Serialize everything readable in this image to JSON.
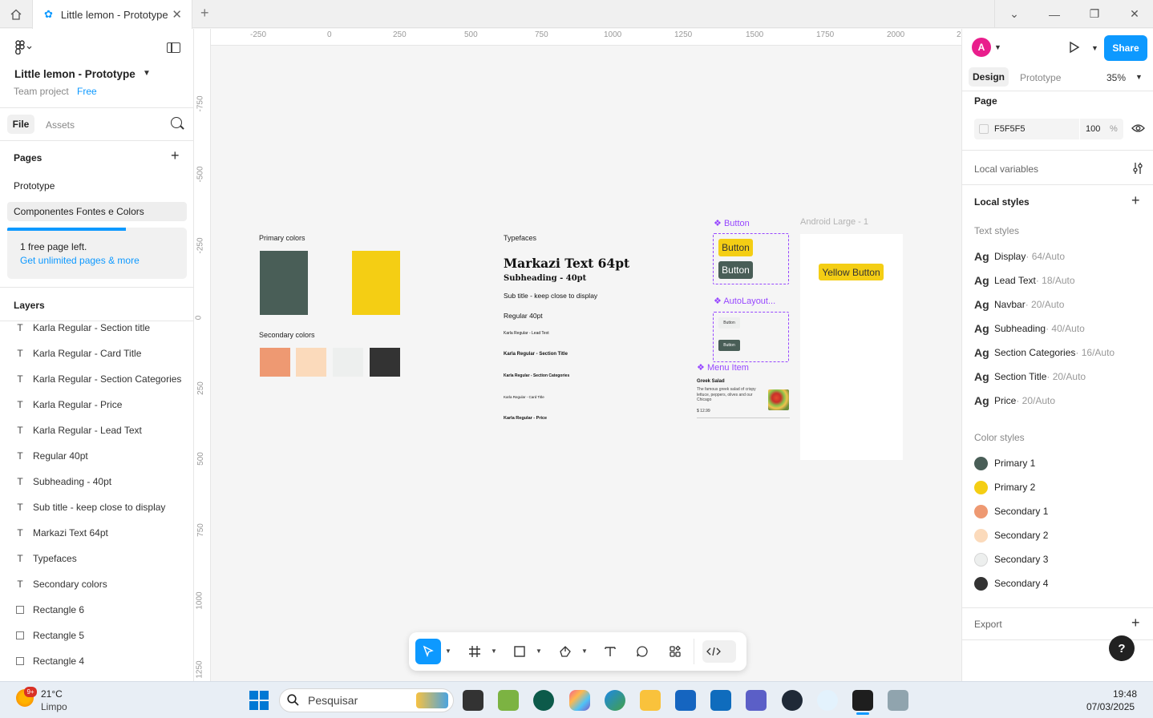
{
  "window": {
    "tab_title": "Little lemon - Prototype"
  },
  "left": {
    "project_title": "Little lemon - Prototype",
    "team": "Team project",
    "plan": "Free",
    "tabs": {
      "file": "File",
      "assets": "Assets"
    },
    "pages_header": "Pages",
    "pages": [
      "Prototype",
      "Componentes Fontes e Colors"
    ],
    "upsell": {
      "line1": "1 free page left.",
      "line2": "Get unlimited pages & more",
      "pages_used_fraction": 0.66
    },
    "layers_header": "Layers",
    "layers": [
      {
        "type": "text",
        "name": "Karla Regular - Section title"
      },
      {
        "type": "text",
        "name": "Karla Regular - Card Title"
      },
      {
        "type": "text",
        "name": "Karla Regular - Section Categories"
      },
      {
        "type": "text",
        "name": "Karla Regular - Price"
      },
      {
        "type": "text",
        "name": "Karla Regular - Lead Text"
      },
      {
        "type": "text",
        "name": "Regular 40pt"
      },
      {
        "type": "text",
        "name": "Subheading - 40pt"
      },
      {
        "type": "text",
        "name": "Sub title - keep close to display"
      },
      {
        "type": "text",
        "name": "Markazi Text 64pt"
      },
      {
        "type": "text",
        "name": "Typefaces"
      },
      {
        "type": "text",
        "name": "Secondary colors"
      },
      {
        "type": "rect",
        "name": "Rectangle 6"
      },
      {
        "type": "rect",
        "name": "Rectangle 5"
      },
      {
        "type": "rect",
        "name": "Rectangle 4"
      }
    ]
  },
  "ruler": {
    "top": [
      "-250",
      "0",
      "250",
      "500",
      "750",
      "1000",
      "1250",
      "1500",
      "1750",
      "2000",
      "2"
    ],
    "left": [
      "-750",
      "-500",
      "-250",
      "0",
      "250",
      "500",
      "750",
      "1000",
      "1250"
    ]
  },
  "canvas": {
    "primary_label": "Primary colors",
    "secondary_label": "Secondary colors",
    "typefaces_label": "Typefaces",
    "type_samples": {
      "display": "Markazi Text 64pt",
      "subheading": "Subheading - 40pt",
      "subtitle": "Sub title - keep close to display",
      "regular": "Regular 40pt",
      "lead": "Karla Regular - Lead Text",
      "section_title": "Karla Regular - Section Title",
      "section_categories": "Karla Regular - Section Categories",
      "card_title": "Karla Regular - Card Title",
      "price": "Karla Regular - Price"
    },
    "button_component": {
      "label": "Button",
      "variant1": "Button",
      "variant2": "Button"
    },
    "autolayout_component": {
      "label": "AutoLayout...",
      "btn1": "Button",
      "btn2": "Button"
    },
    "menu_item": {
      "label": "Menu Item",
      "title": "Greek Salad",
      "desc": "The famous greek salad of crispy lettuce, peppers, olives and our Chicago",
      "price": "$ 12.99"
    },
    "frame": {
      "label": "Android Large - 1",
      "button": "Yellow Button"
    }
  },
  "right": {
    "avatar_initial": "A",
    "share": "Share",
    "tabs": {
      "design": "Design",
      "prototype": "Prototype"
    },
    "zoom": "35%",
    "page_header": "Page",
    "page_color": "F5F5F5",
    "page_opacity": "100",
    "percent": "%",
    "local_variables": "Local variables",
    "local_styles": "Local styles",
    "text_styles_header": "Text styles",
    "ag": "Ag",
    "text_styles": [
      {
        "name": "Display",
        "meta": " · 64/Auto"
      },
      {
        "name": "Lead Text",
        "meta": " · 18/Auto"
      },
      {
        "name": "Navbar",
        "meta": " · 20/Auto"
      },
      {
        "name": "Subheading",
        "meta": " · 40/Auto"
      },
      {
        "name": "Section Categories",
        "meta": " · 16/Auto"
      },
      {
        "name": "Section Title",
        "meta": " · 20/Auto"
      },
      {
        "name": "Price",
        "meta": " · 20/Auto"
      }
    ],
    "color_styles_header": "Color styles",
    "color_styles": [
      {
        "name": "Primary 1",
        "color": "#495E57"
      },
      {
        "name": "Primary 2",
        "color": "#F4CE14"
      },
      {
        "name": "Secondary 1",
        "color": "#EE9972"
      },
      {
        "name": "Secondary 2",
        "color": "#FBDABB"
      },
      {
        "name": "Secondary 3",
        "color": "#EDEFEE"
      },
      {
        "name": "Secondary 4",
        "color": "#333333"
      }
    ],
    "export": "Export",
    "help": "?"
  },
  "taskbar": {
    "weather_temp": "21°C",
    "weather_desc": "Limpo",
    "badge": "9+",
    "search_placeholder": "Pesquisar",
    "time": "19:48",
    "date": "07/03/2025"
  }
}
